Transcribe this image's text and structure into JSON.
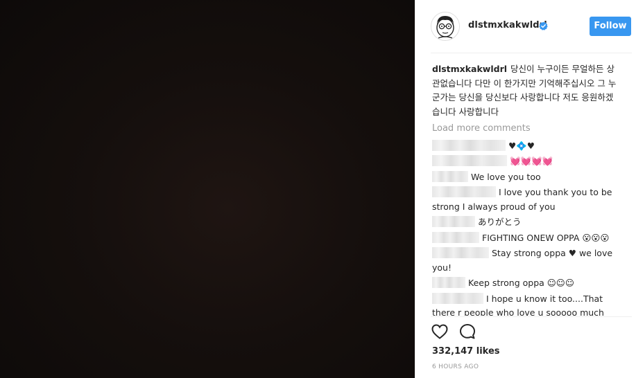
{
  "post": {
    "username": "dlstmxkakwldrl",
    "follow_label": "Follow",
    "caption_username": "dlstmxkakwldrl",
    "caption_text": "당신이 누구이든 무얼하든 상관없습니다 다만 이 한가지만 기억해주십시오 그 누군가는 당신을 당신보다 사랑합니다 저도 응원하겠습니다 사랑합니다",
    "load_more": "Load more comments",
    "comments": [
      {
        "text": "♥💠♥"
      },
      {
        "text": "💓💓💓💓"
      },
      {
        "text": "We love you too"
      },
      {
        "text": "I love you thank you to be strong I always proud of you"
      },
      {
        "text": "ありがとう"
      },
      {
        "text": "FIGHTING ONEW OPPA 😮😮😮"
      },
      {
        "text": "Stay strong oppa ♥ we love you!"
      },
      {
        "text": "Keep strong oppa ☺☺☺"
      },
      {
        "text": "I hope u know it too....That there r people who love u sooooo much"
      }
    ],
    "likes": "332,147 likes",
    "timestamp": "6 HOURS AGO"
  },
  "colors": {
    "follow_button": "#3897f0",
    "verified_badge": "#3897f0",
    "photo_background": "#150f0d"
  },
  "icons": [
    "verified-badge-icon",
    "heart-icon",
    "comment-icon"
  ]
}
